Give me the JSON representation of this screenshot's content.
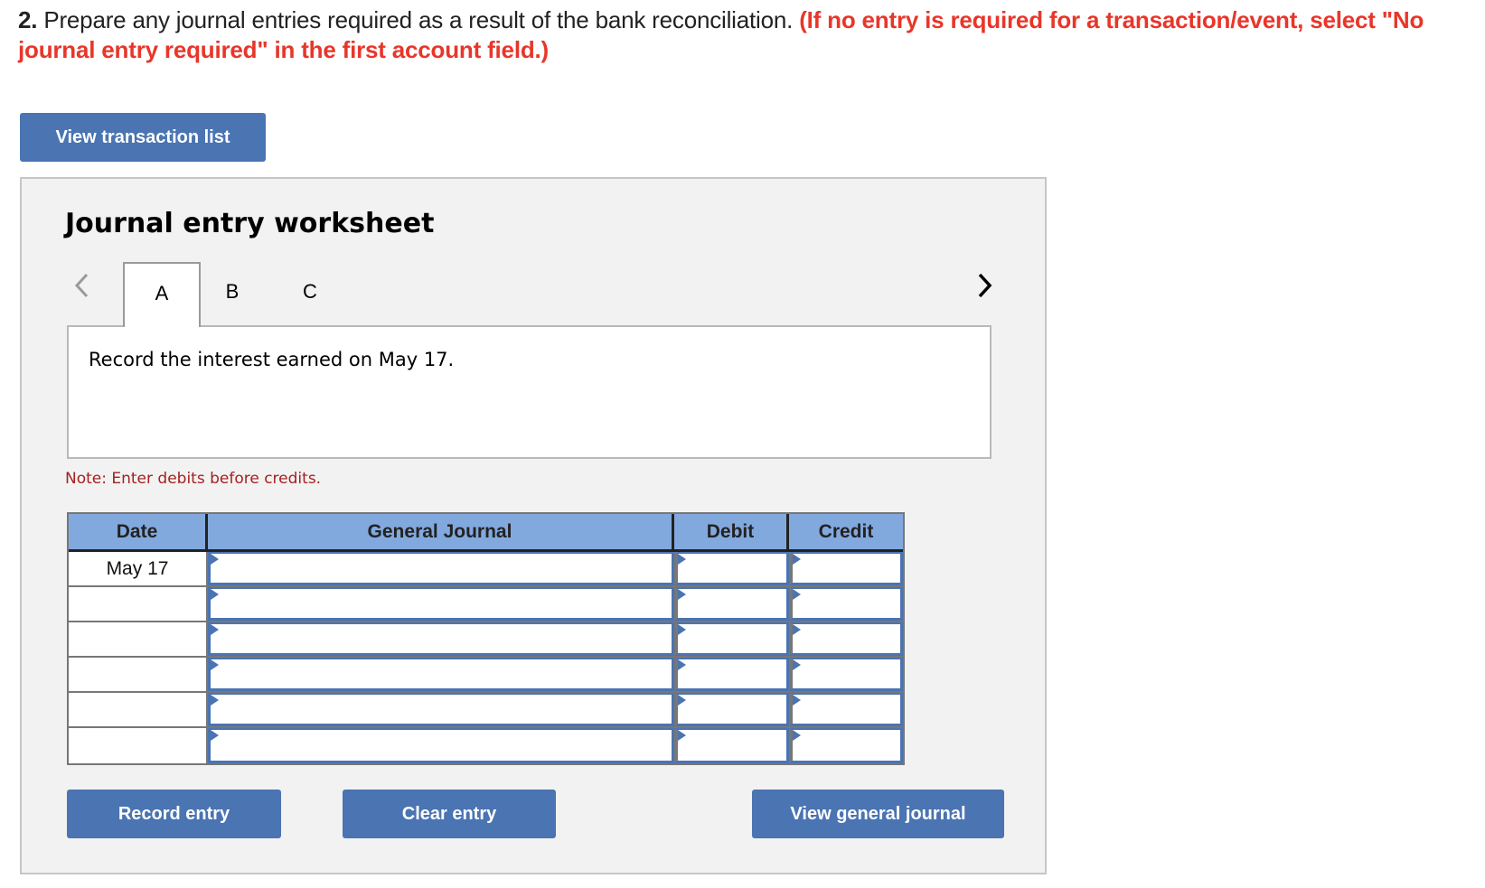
{
  "instructions": {
    "number": "2.",
    "text": " Prepare any journal entries required as a result of the bank reconciliation. ",
    "warning": "(If no entry is required for a transaction/event, select \"No journal entry required\" in the first account field.)"
  },
  "buttons": {
    "view_transaction_list": "View transaction list",
    "record_entry": "Record entry",
    "clear_entry": "Clear entry",
    "view_general_journal": "View general journal"
  },
  "worksheet": {
    "title": "Journal entry worksheet",
    "tabs": [
      {
        "label": "A",
        "active": true
      },
      {
        "label": "B",
        "active": false
      },
      {
        "label": "C",
        "active": false
      }
    ],
    "description": "Record the interest earned on May 17.",
    "note": "Note: Enter debits before credits."
  },
  "journal": {
    "headers": [
      "Date",
      "General Journal",
      "Debit",
      "Credit"
    ],
    "rows": [
      {
        "date": "May 17",
        "account": "",
        "debit": "",
        "credit": ""
      },
      {
        "date": "",
        "account": "",
        "debit": "",
        "credit": ""
      },
      {
        "date": "",
        "account": "",
        "debit": "",
        "credit": ""
      },
      {
        "date": "",
        "account": "",
        "debit": "",
        "credit": ""
      },
      {
        "date": "",
        "account": "",
        "debit": "",
        "credit": ""
      },
      {
        "date": "",
        "account": "",
        "debit": "",
        "credit": ""
      }
    ]
  },
  "colors": {
    "button": "#4a74b2",
    "warning": "#e8362a",
    "header": "#82a9de",
    "note": "#a52020"
  },
  "icons": {
    "prev": "chevron-left-icon",
    "next": "chevron-right-icon",
    "cell_flag": "dropdown-flag-icon"
  }
}
